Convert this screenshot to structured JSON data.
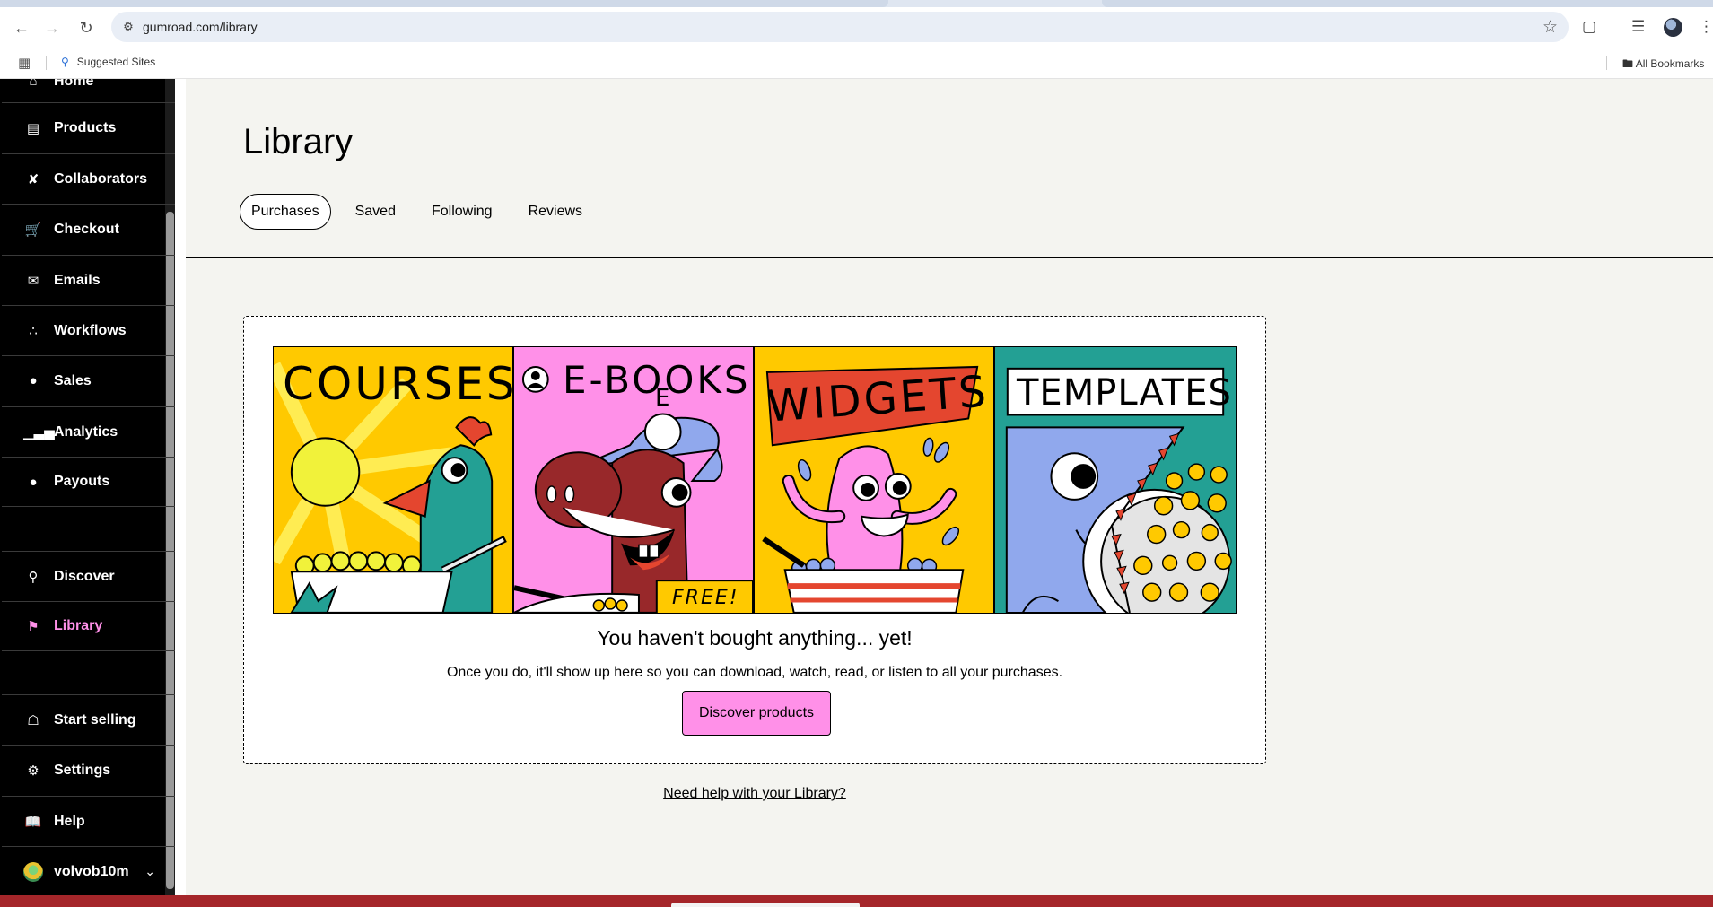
{
  "browser": {
    "url": "gumroad.com/library",
    "bookmarks": {
      "suggested": "Suggested Sites",
      "all": "All Bookmarks"
    }
  },
  "sidebar": {
    "items": [
      {
        "label": "Home",
        "icon": "home-icon"
      },
      {
        "label": "Products",
        "icon": "archive-icon"
      },
      {
        "label": "Collaborators",
        "icon": "handshake-icon"
      },
      {
        "label": "Checkout",
        "icon": "cart-icon"
      },
      {
        "label": "Emails",
        "icon": "envelope-icon"
      },
      {
        "label": "Workflows",
        "icon": "workflow-icon"
      },
      {
        "label": "Sales",
        "icon": "dollar-circle-icon"
      },
      {
        "label": "Analytics",
        "icon": "bar-chart-icon"
      },
      {
        "label": "Payouts",
        "icon": "dollar-circle-icon"
      },
      {
        "label": "Discover",
        "icon": "search-icon"
      },
      {
        "label": "Library",
        "icon": "bookmark-icon"
      },
      {
        "label": "Start selling",
        "icon": "shop-icon"
      },
      {
        "label": "Settings",
        "icon": "gear-icon"
      },
      {
        "label": "Help",
        "icon": "book-icon"
      }
    ],
    "user": "volvob10m",
    "active": "Library",
    "accent_color": "#ff90e8"
  },
  "main": {
    "title": "Library",
    "tabs": [
      "Purchases",
      "Saved",
      "Following",
      "Reviews"
    ],
    "active_tab": "Purchases",
    "illustration": {
      "panels": [
        "COURSES",
        "E-BOOKS",
        "WIDGETS",
        "TEMPLATES"
      ],
      "badge": "FREE!",
      "ebook_letter": "E"
    },
    "empty_title": "You haven't bought anything... yet!",
    "empty_desc": "Once you do, it'll show up here so you can download, watch, read, or listen to all your purchases.",
    "cta": "Discover products",
    "help_link": "Need help with your Library?"
  }
}
